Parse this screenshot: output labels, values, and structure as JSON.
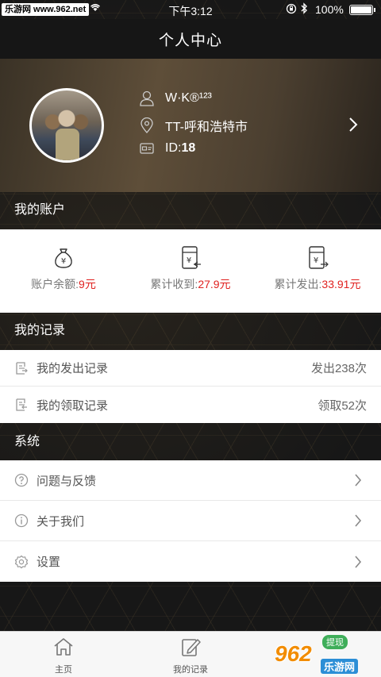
{
  "status_bar": {
    "watermark": "乐游网 www.962.net",
    "time": "下午3:12",
    "battery": "100%"
  },
  "nav": {
    "title": "个人中心"
  },
  "profile": {
    "name": "W·K®¹²³",
    "city": "TT-呼和浩特市",
    "id_label": "ID:",
    "id_value": "18"
  },
  "account": {
    "heading": "我的账户",
    "items": [
      {
        "label": "账户余额:",
        "value": "9元",
        "icon": "money-bag-icon"
      },
      {
        "label": "累计收到:",
        "value": "27.9元",
        "icon": "receive-doc-icon"
      },
      {
        "label": "累计发出:",
        "value": "33.91元",
        "icon": "send-doc-icon"
      }
    ]
  },
  "records": {
    "heading": "我的记录",
    "items": [
      {
        "label": "我的发出记录",
        "value": "发出238次"
      },
      {
        "label": "我的领取记录",
        "value": "领取52次"
      }
    ]
  },
  "system": {
    "heading": "系统",
    "items": [
      {
        "label": "问题与反馈",
        "icon": "question-icon"
      },
      {
        "label": "关于我们",
        "icon": "info-icon"
      },
      {
        "label": "设置",
        "icon": "settings-gear-icon"
      }
    ]
  },
  "tabbar": {
    "home": "主页",
    "records": "我的记录"
  },
  "watermark_logo": {
    "badge": "提现",
    "logo": "962",
    "cn": "乐游网"
  },
  "colors": {
    "accent_red": "#e0211f",
    "header_bg": "#161616"
  }
}
